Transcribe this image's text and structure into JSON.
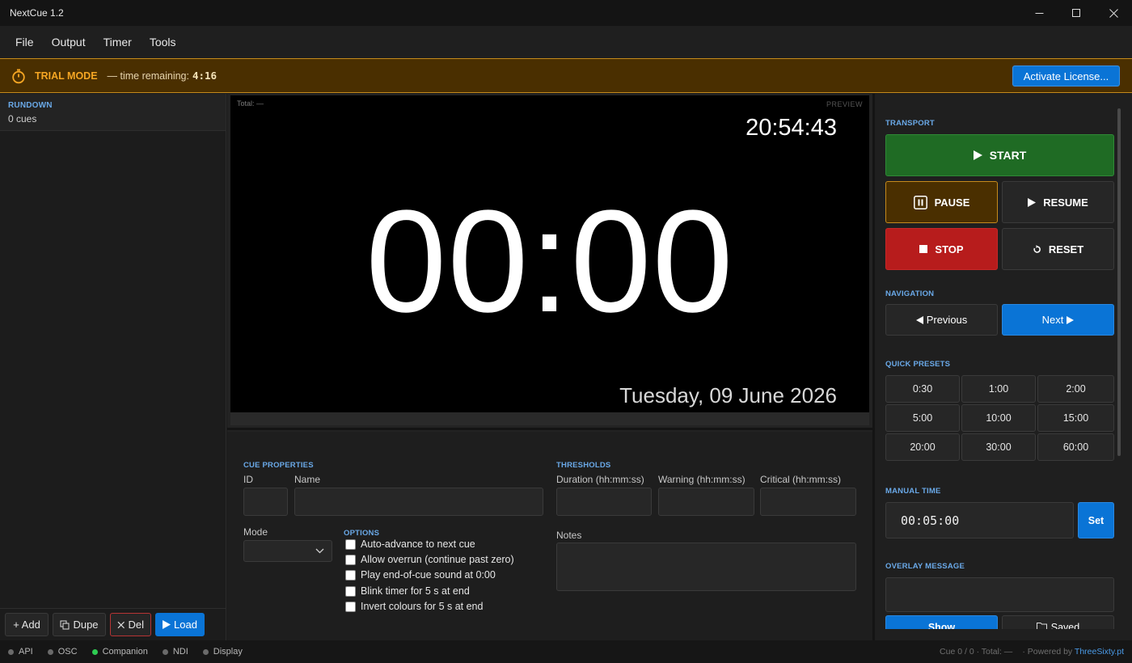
{
  "window": {
    "title": "NextCue  1.2"
  },
  "menu": [
    "File",
    "Output",
    "Timer",
    "Tools"
  ],
  "trial": {
    "mode_label": "TRIAL MODE",
    "remaining_label": "— time remaining:",
    "remaining_value": "4:16",
    "activate_label": "Activate License..."
  },
  "rundown": {
    "title": "RUNDOWN",
    "count": "0 cues",
    "buttons": {
      "add": "+ Add",
      "dupe": "Dupe",
      "del": "Del",
      "load": "Load"
    }
  },
  "preview": {
    "total": "Total: —",
    "label": "PREVIEW",
    "clock": "20:54:43",
    "countdown": "00:00",
    "date": "Tuesday, 09 June 2026"
  },
  "cue_properties": {
    "title": "CUE PROPERTIES",
    "id_label": "ID",
    "name_label": "Name",
    "mode_label": "Mode",
    "options_title": "OPTIONS",
    "options": [
      "Auto-advance to next cue",
      "Allow overrun (continue past zero)",
      "Play end-of-cue sound at 0:00",
      "Blink timer for 5 s at end",
      "Invert colours for 5 s at end"
    ]
  },
  "thresholds": {
    "title": "THRESHOLDS",
    "duration_label": "Duration (hh:mm:ss)",
    "warning_label": "Warning (hh:mm:ss)",
    "critical_label": "Critical (hh:mm:ss)",
    "notes_label": "Notes"
  },
  "transport": {
    "title": "TRANSPORT",
    "start": "START",
    "pause": "PAUSE",
    "resume": "RESUME",
    "stop": "STOP",
    "reset": "RESET"
  },
  "navigation": {
    "title": "NAVIGATION",
    "previous": "Previous",
    "next": "Next"
  },
  "presets": {
    "title": "QUICK PRESETS",
    "items": [
      "0:30",
      "1:00",
      "2:00",
      "5:00",
      "10:00",
      "15:00",
      "20:00",
      "30:00",
      "60:00"
    ]
  },
  "manual_time": {
    "title": "MANUAL TIME",
    "value": "00:05:00",
    "set_label": "Set"
  },
  "overlay": {
    "title": "OVERLAY MESSAGE",
    "show_label": "Show",
    "saved_label": "Saved"
  },
  "status": {
    "items": [
      {
        "label": "API",
        "active": false
      },
      {
        "label": "OSC",
        "active": false
      },
      {
        "label": "Companion",
        "active": true
      },
      {
        "label": "NDI",
        "active": false
      },
      {
        "label": "Display",
        "active": false
      }
    ],
    "cue_info": "Cue 0 / 0 · Total: —",
    "powered_label": "· Powered by",
    "brand": "ThreeSixty.pt"
  },
  "colors": {
    "accent": "#0a74d6",
    "trial_bg": "#4a2f00",
    "trial_text": "#f5a623",
    "start_green": "#1f6b24",
    "stop_red": "#b71c1c",
    "section_label": "#6aa9e8",
    "status_active": "#2ecc52"
  }
}
